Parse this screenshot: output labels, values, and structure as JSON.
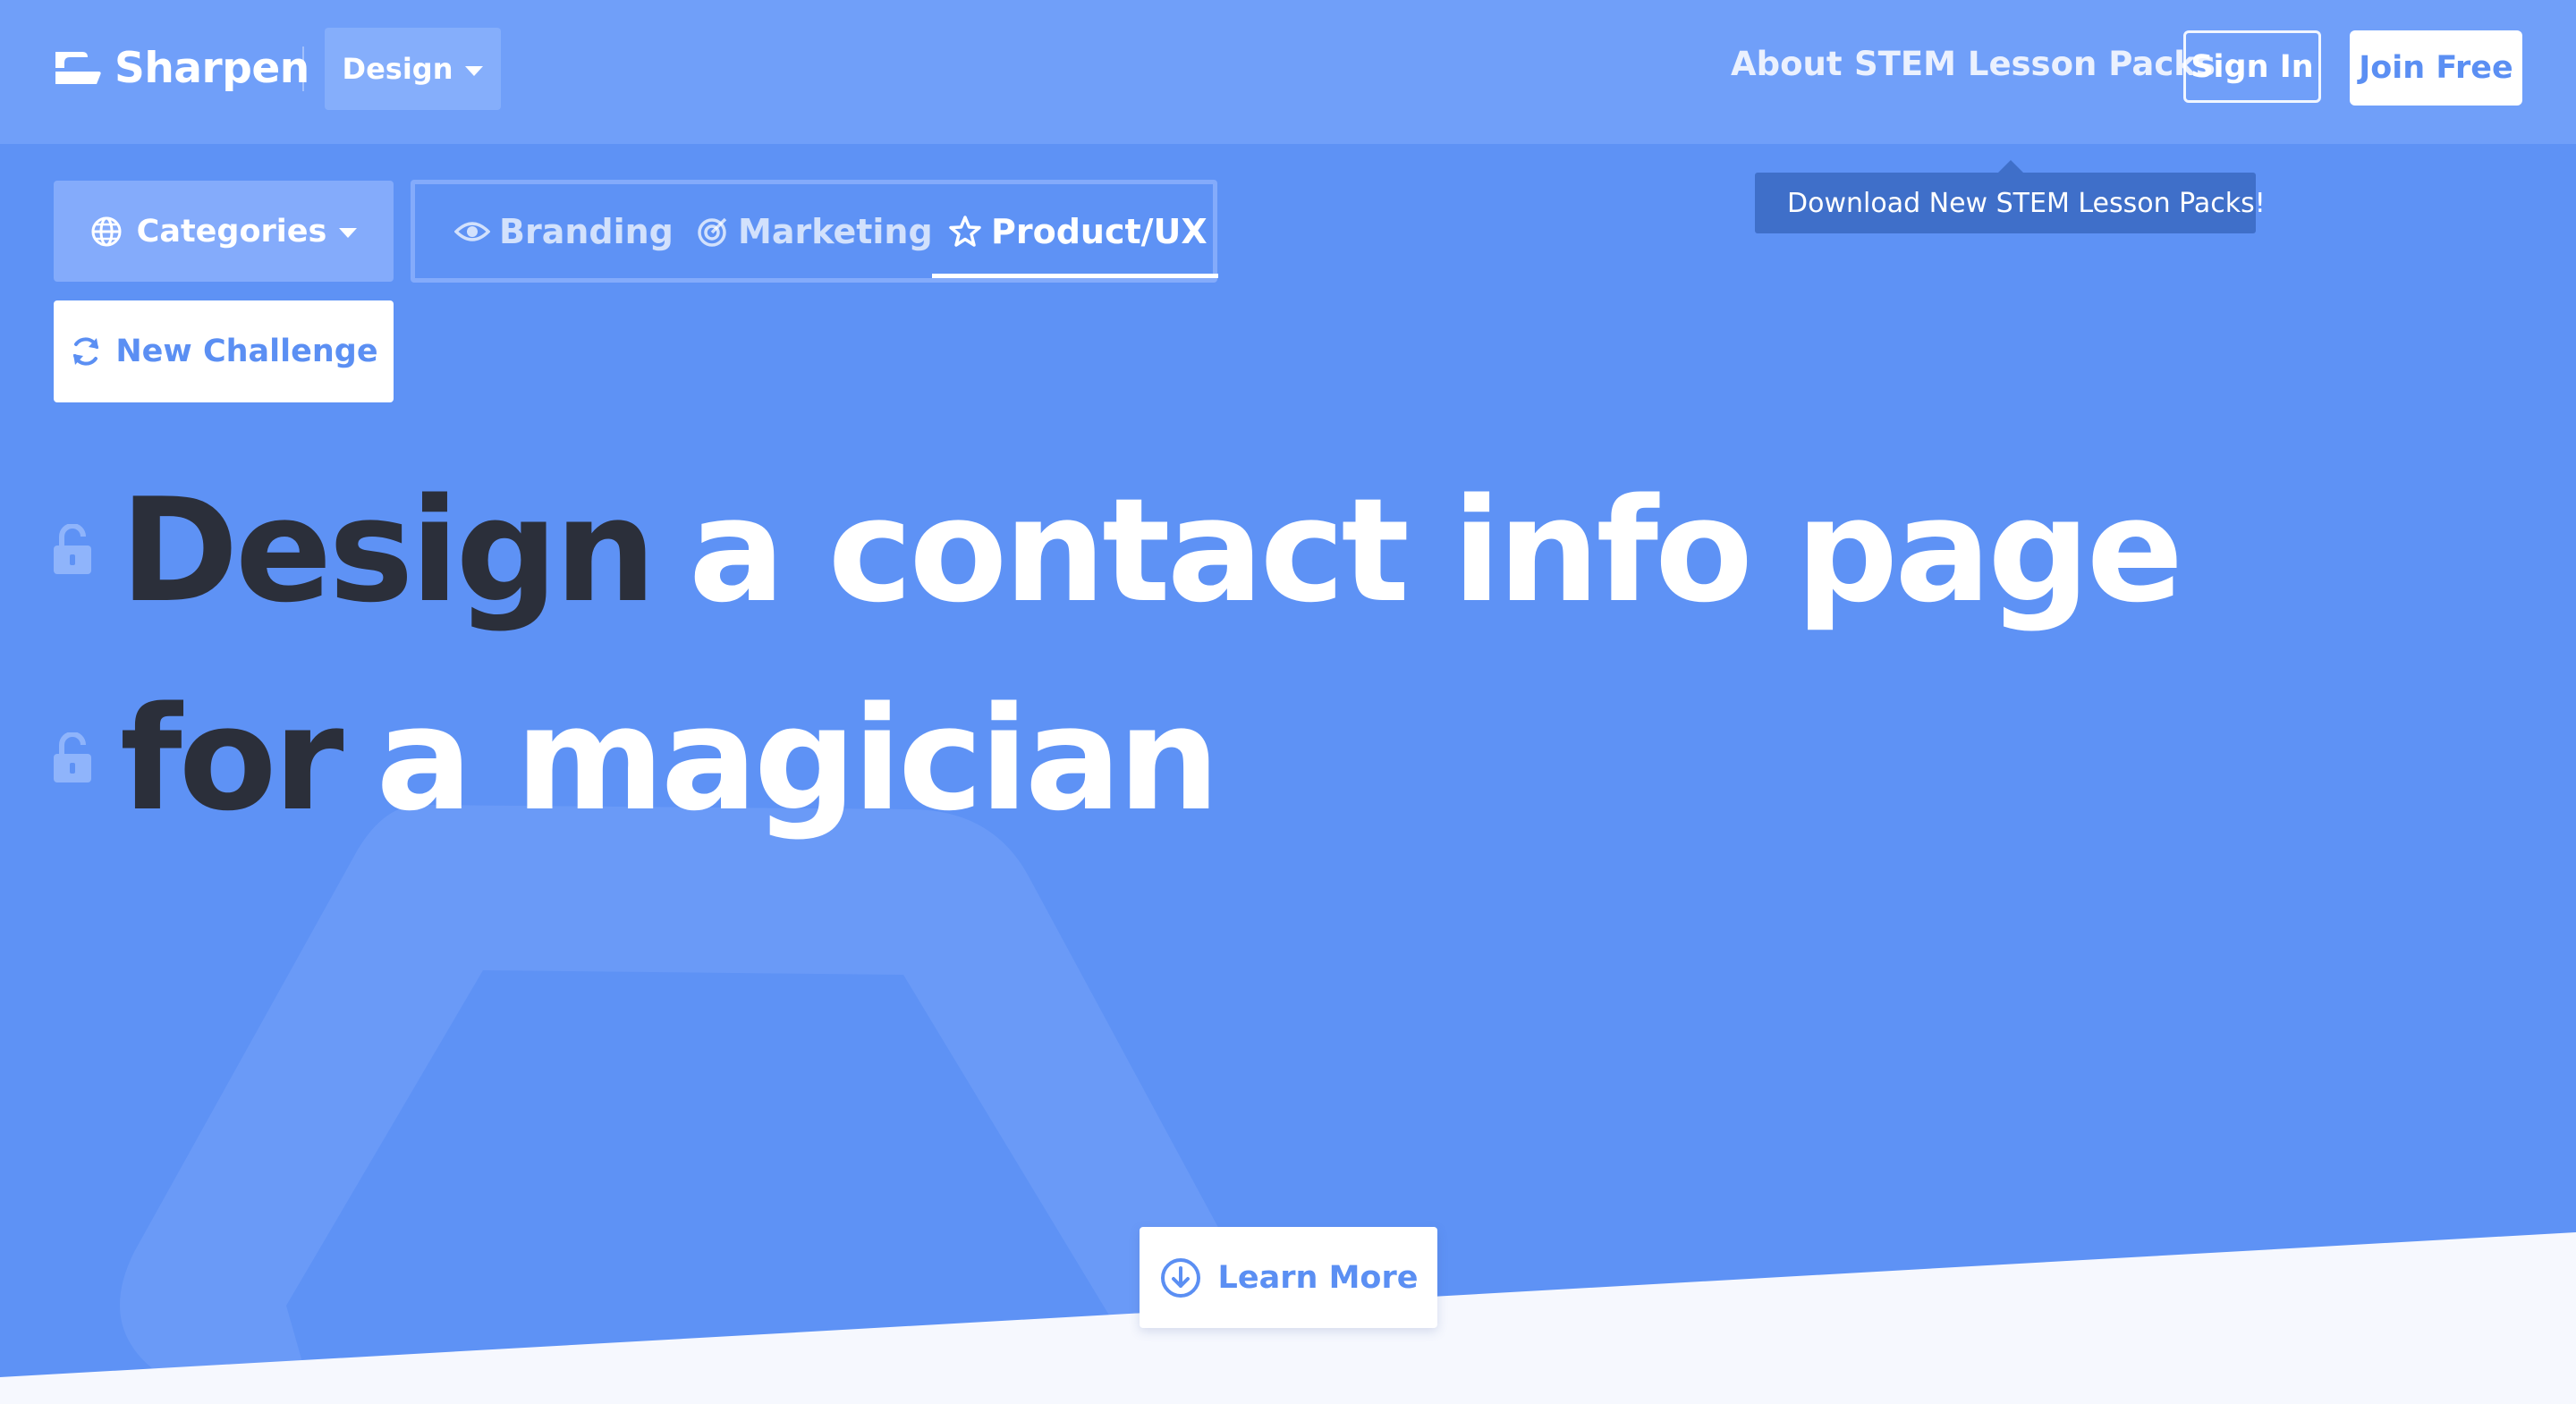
{
  "brand": {
    "name": "Sharpen"
  },
  "nav": {
    "section_dropdown": "Design",
    "about": "About",
    "stem_packs": "STEM Lesson Packs",
    "sign_in": "Sign In",
    "join_free": "Join Free"
  },
  "tooltip": {
    "icon": "star-burst-icon",
    "text": "Download New STEM Lesson Packs!"
  },
  "filters": {
    "categories_label": "Categories",
    "tabs": [
      {
        "label": "Branding",
        "icon": "eye-icon",
        "active": false
      },
      {
        "label": "Marketing",
        "icon": "target-icon",
        "active": false
      },
      {
        "label": "Product/UX",
        "icon": "star-icon",
        "active": true
      }
    ],
    "new_challenge": "New Challenge"
  },
  "challenge": {
    "line1_verb": "Design",
    "line1_object": "a contact info page",
    "line2_prefix": "for",
    "line2_subject": "a magician"
  },
  "learn_more": "Learn More",
  "colors": {
    "background": "#5e92f5",
    "topbar": "#709ff9",
    "accent_text": "#5b8ff3",
    "dark_text": "#2b2f3a",
    "tooltip": "#3f6fc9",
    "footer": "#f6f8fe"
  }
}
